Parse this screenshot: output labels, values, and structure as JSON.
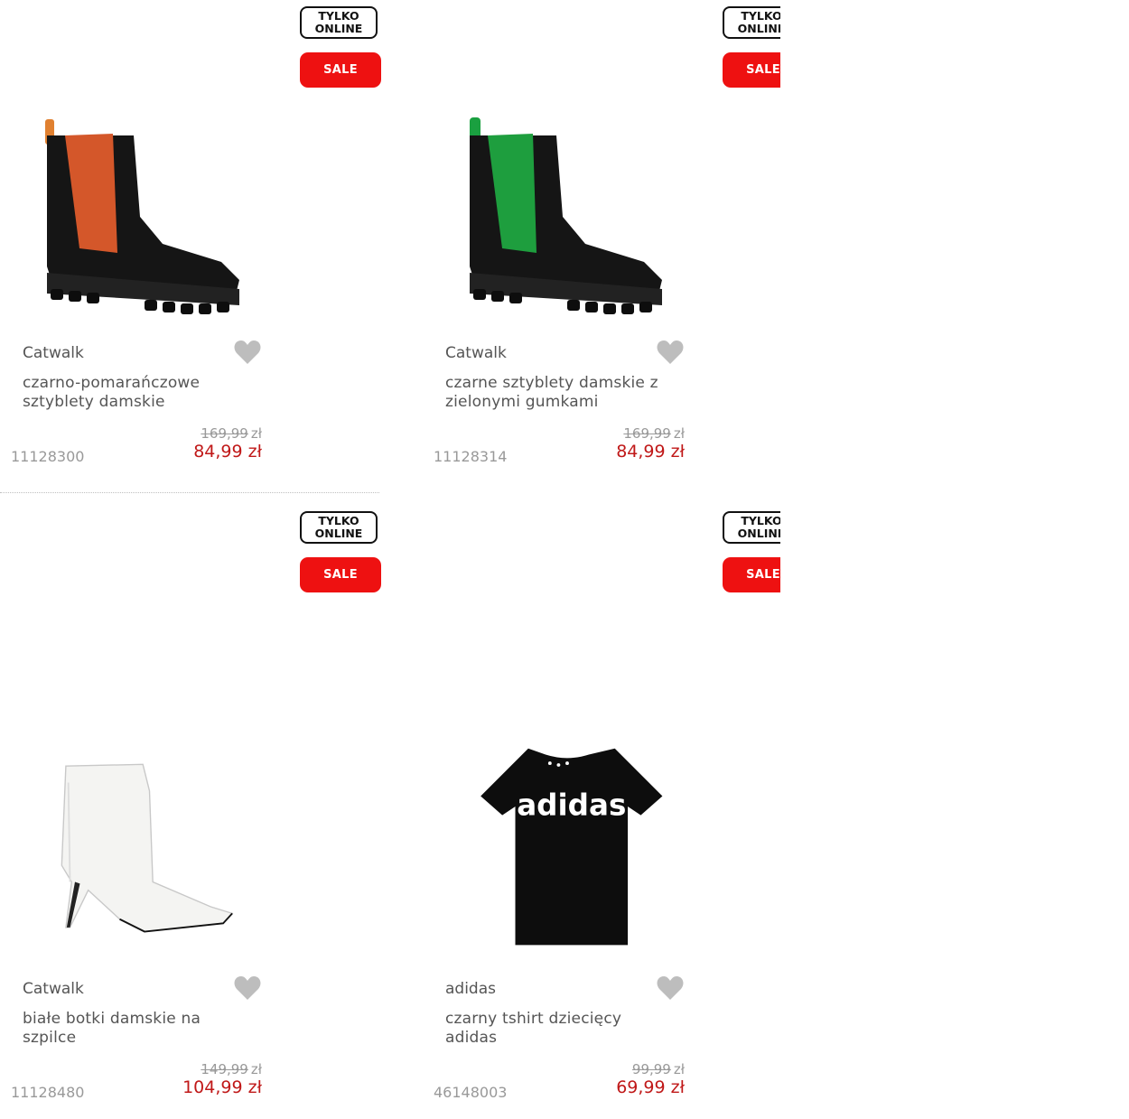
{
  "badges": {
    "online_line1": "TYLKO",
    "online_line2": "ONLINE",
    "sale": "SALE"
  },
  "colors": {
    "sale": "#ee1111",
    "price": "#c01818",
    "heart": "#bdbdbd"
  },
  "products": [
    {
      "brand": "Catwalk",
      "title": "czarno-pomarańczowe sztyblety damskie",
      "old_price": "169,99",
      "old_currency": "zł",
      "price": "84,99 zł",
      "sku": "11128300",
      "image": "black-chelsea-boot-orange-elastic"
    },
    {
      "brand": "Catwalk",
      "title": "czarne sztyblety damskie z zielonymi gumkami",
      "old_price": "169,99",
      "old_currency": "zł",
      "price": "84,99 zł",
      "sku": "11128314",
      "image": "black-chelsea-boot-green-elastic"
    },
    {
      "brand": "Catwalk",
      "title": "białe botki damskie na szpilce",
      "old_price": "149,99",
      "old_currency": "zł",
      "price": "104,99 zł",
      "sku": "11128480",
      "image": "white-stiletto-ankle-boot"
    },
    {
      "brand": "adidas",
      "title": "czarny tshirt dziecięcy adidas",
      "old_price": "99,99",
      "old_currency": "zł",
      "price": "69,99 zł",
      "sku": "46148003",
      "image": "black-adidas-tshirt",
      "image_text": "adidas"
    }
  ]
}
